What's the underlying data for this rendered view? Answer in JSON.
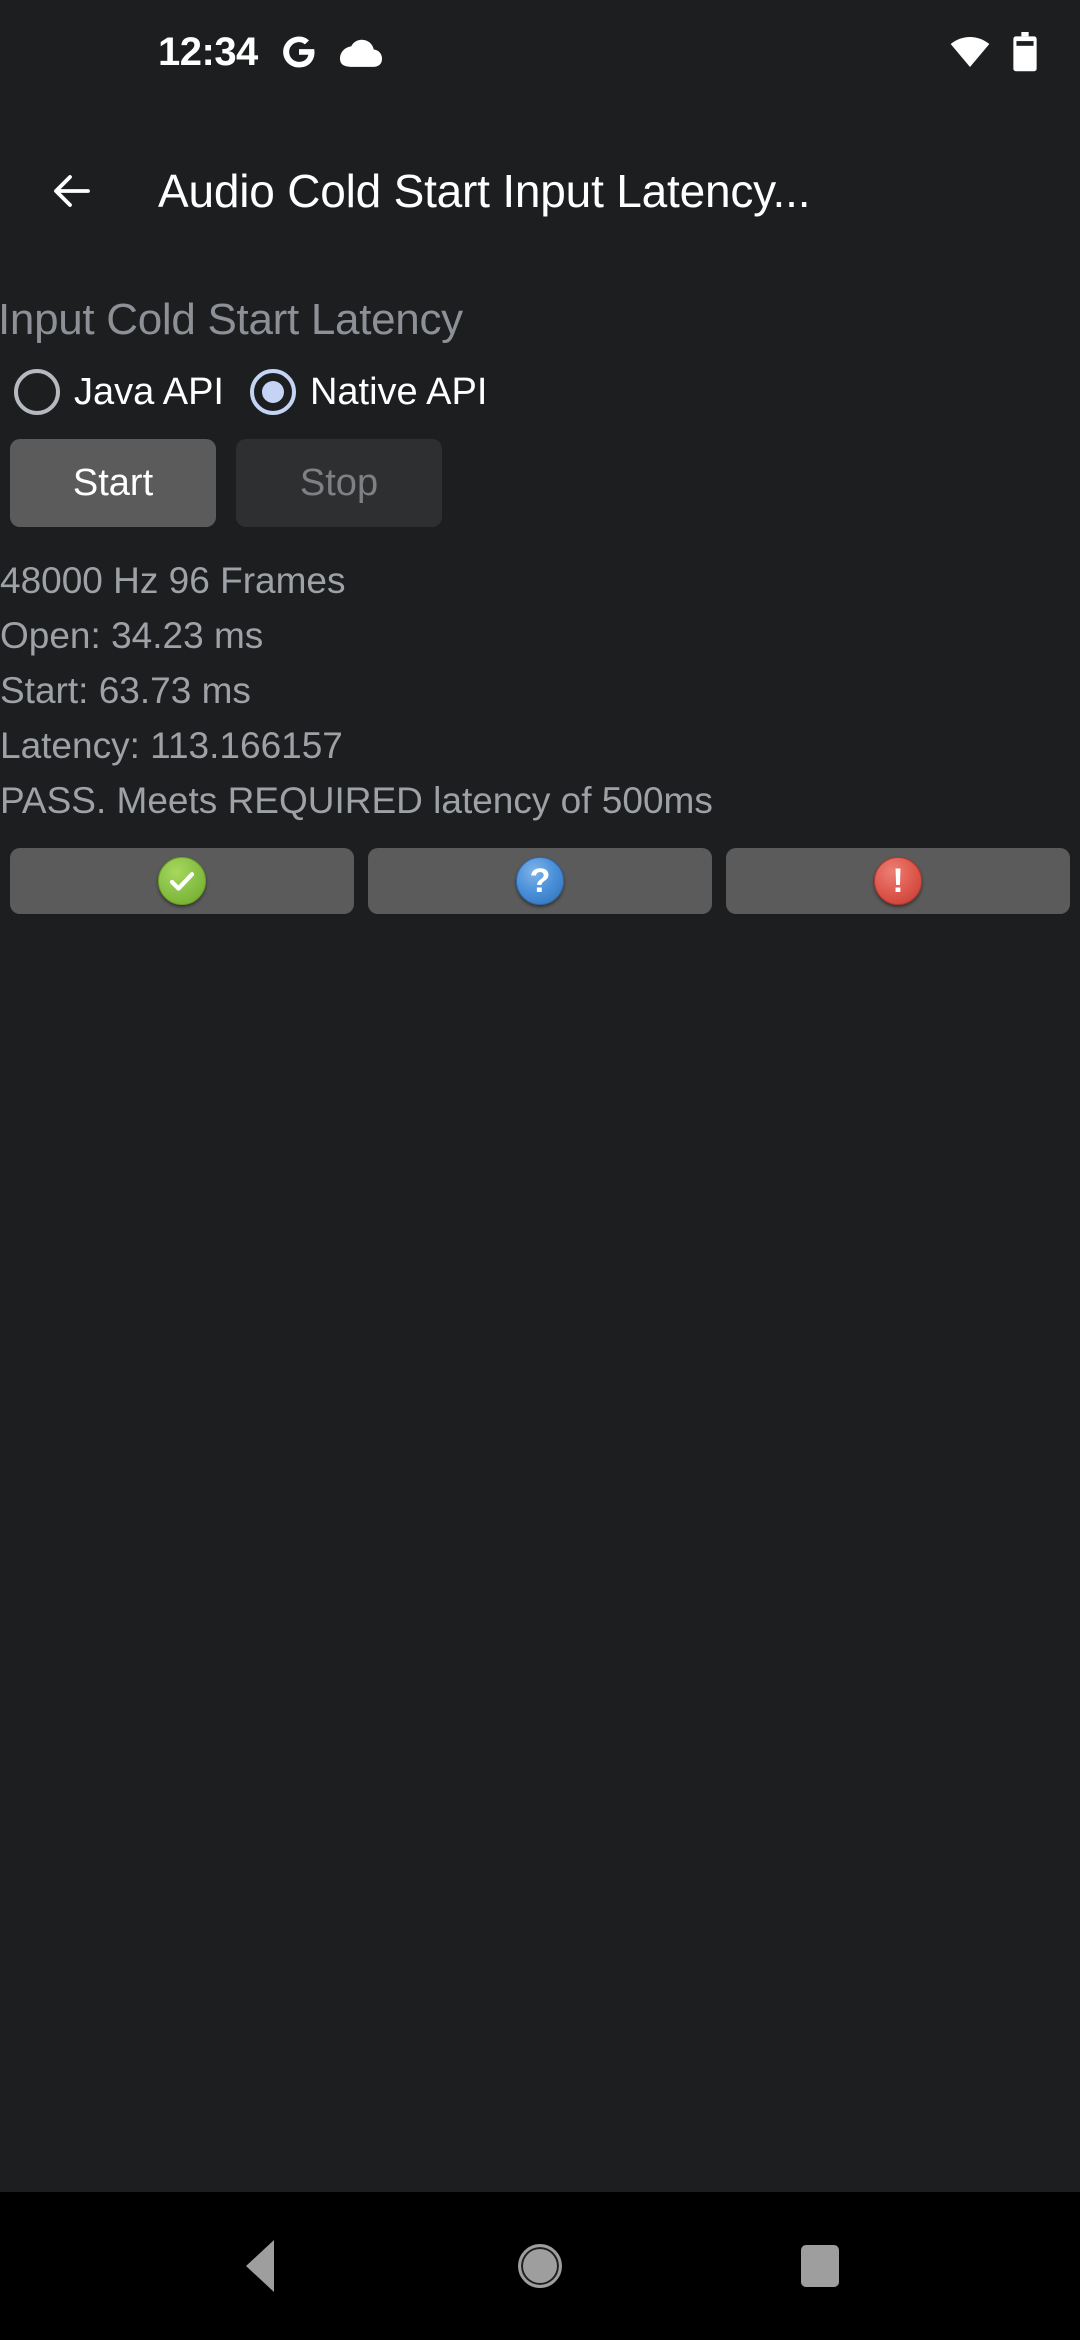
{
  "status_bar": {
    "clock": "12:34",
    "icons_left": [
      "google-g-icon",
      "cloud-icon"
    ],
    "icons_right": [
      "wifi-icon",
      "battery-icon"
    ]
  },
  "toolbar": {
    "back_icon": "back-arrow-icon",
    "title": "Audio Cold Start Input Latency..."
  },
  "main": {
    "section_title": "Input Cold Start Latency",
    "api_options": [
      {
        "label": "Java API",
        "selected": false
      },
      {
        "label": "Native API",
        "selected": true
      }
    ],
    "controls": {
      "start_label": "Start",
      "start_enabled": true,
      "stop_label": "Stop",
      "stop_enabled": false
    },
    "results": [
      "48000 Hz 96 Frames",
      "Open: 34.23 ms",
      "Start: 63.73 ms",
      "Latency: 113.166157",
      "PASS. Meets REQUIRED latency of 500ms"
    ],
    "status_buttons": [
      {
        "icon": "check-circle-icon",
        "glyph": "✔",
        "color": "#8bc34a",
        "name": "pass"
      },
      {
        "icon": "question-circle-icon",
        "glyph": "?",
        "color": "#4a90d9",
        "name": "info"
      },
      {
        "icon": "exclamation-circle-icon",
        "glyph": "!",
        "color": "#df5a4e",
        "name": "fail"
      }
    ]
  },
  "nav_bar": {
    "back_label": "Back",
    "home_label": "Home",
    "recents_label": "Recents"
  },
  "colors": {
    "background": "#1d1e20",
    "nav_background": "#000000",
    "accent_radio": "#c5d4f5",
    "button_enabled": "#5b5b5b",
    "button_disabled": "#2e2f31",
    "text_primary": "#ffffff",
    "text_secondary": "#9ea1a6"
  }
}
